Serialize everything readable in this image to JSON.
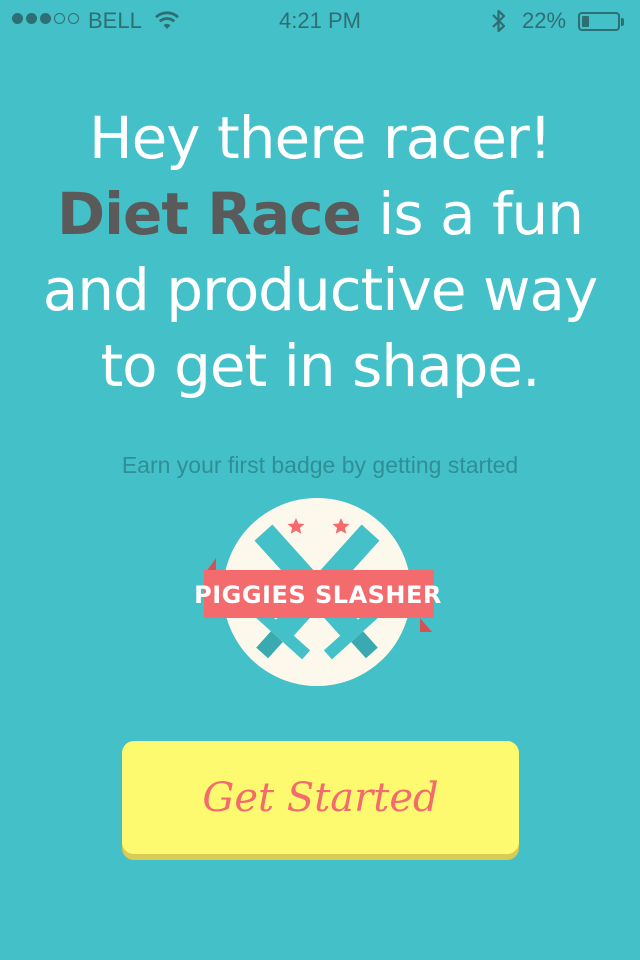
{
  "status_bar": {
    "carrier": "BELL",
    "time": "4:21 PM",
    "battery_percent_text": "22%",
    "battery_level": 0.22,
    "signal_bars_filled": 3,
    "signal_bars_total": 5
  },
  "headline": {
    "line1": "Hey there racer!",
    "brand": "Diet Race",
    "line2_rest": " is a fun",
    "line3": "and productive way",
    "line4": "to get in shape."
  },
  "subtitle": "Earn your first badge by getting started",
  "badge": {
    "title": "PIGGIES SLASHER",
    "colors": {
      "circle": "#fcf9ec",
      "ribbon": "#f36b6d",
      "ribbon_fold": "#d84f54",
      "swords": "#44c0c8",
      "stars": "#f36b6d"
    }
  },
  "cta": {
    "label": "Get Started"
  },
  "colors": {
    "background": "#44c0c8",
    "headline": "#ffffff",
    "brand": "#5a5a5a",
    "button": "#fefa6f",
    "button_text": "#f36b6d"
  }
}
